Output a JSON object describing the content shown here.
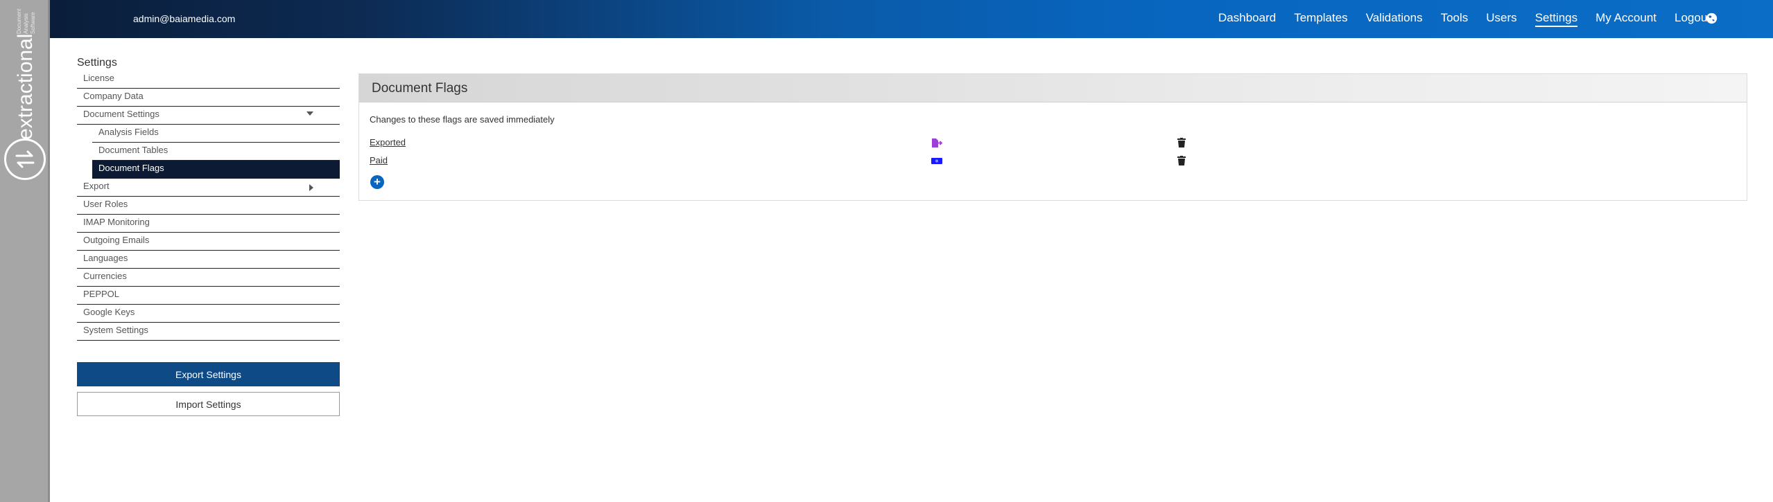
{
  "brand": {
    "name": "extractional",
    "tagline": "Document Analysis Software"
  },
  "header": {
    "user_email": "admin@baiamedia.com",
    "nav": [
      {
        "label": "Dashboard"
      },
      {
        "label": "Templates"
      },
      {
        "label": "Validations"
      },
      {
        "label": "Tools"
      },
      {
        "label": "Users"
      },
      {
        "label": "Settings",
        "active": true
      },
      {
        "label": "My Account"
      },
      {
        "label": "Logout"
      }
    ],
    "language_icon": "globe-icon"
  },
  "sidebar": {
    "title": "Settings",
    "items": [
      {
        "label": "License"
      },
      {
        "label": "Company Data"
      },
      {
        "label": "Document Settings",
        "expanded": true
      },
      {
        "label": "Analysis Fields",
        "sub": true
      },
      {
        "label": "Document Tables",
        "sub": true
      },
      {
        "label": "Document Flags",
        "sub": true,
        "active": true
      },
      {
        "label": "Export",
        "collapsed": true
      },
      {
        "label": "User Roles"
      },
      {
        "label": "IMAP Monitoring"
      },
      {
        "label": "Outgoing Emails"
      },
      {
        "label": "Languages"
      },
      {
        "label": "Currencies"
      },
      {
        "label": "PEPPOL"
      },
      {
        "label": "Google Keys"
      },
      {
        "label": "System Settings"
      }
    ],
    "export_button": "Export Settings",
    "import_button": "Import Settings"
  },
  "panel": {
    "title": "Document Flags",
    "note": "Changes to these flags are saved immediately",
    "flags": [
      {
        "name": "Exported",
        "color": "#9b3fd6",
        "icon": "file-export-icon"
      },
      {
        "name": "Paid",
        "color": "#1a1aff",
        "icon": "money-bill-icon"
      }
    ],
    "add_label": "+"
  },
  "colors": {
    "accent": "#0866c0",
    "active_nav_bg": "#0c1b33",
    "export_button_bg": "#0d4a86",
    "delete_icon": "#222222"
  }
}
